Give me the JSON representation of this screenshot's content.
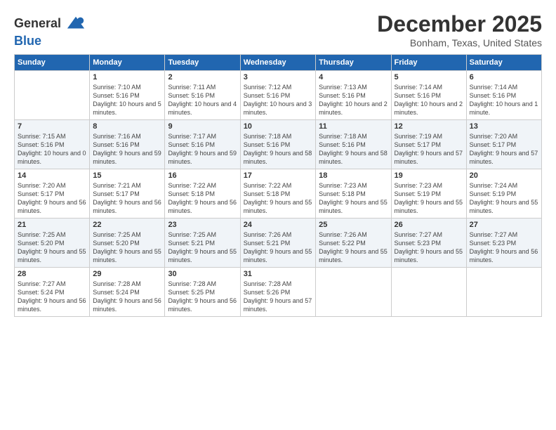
{
  "logo": {
    "line1": "General",
    "line2": "Blue"
  },
  "title": "December 2025",
  "location": "Bonham, Texas, United States",
  "days_header": [
    "Sunday",
    "Monday",
    "Tuesday",
    "Wednesday",
    "Thursday",
    "Friday",
    "Saturday"
  ],
  "weeks": [
    [
      {
        "day": "",
        "sunrise": "",
        "sunset": "",
        "daylight": ""
      },
      {
        "day": "1",
        "sunrise": "Sunrise: 7:10 AM",
        "sunset": "Sunset: 5:16 PM",
        "daylight": "Daylight: 10 hours and 5 minutes."
      },
      {
        "day": "2",
        "sunrise": "Sunrise: 7:11 AM",
        "sunset": "Sunset: 5:16 PM",
        "daylight": "Daylight: 10 hours and 4 minutes."
      },
      {
        "day": "3",
        "sunrise": "Sunrise: 7:12 AM",
        "sunset": "Sunset: 5:16 PM",
        "daylight": "Daylight: 10 hours and 3 minutes."
      },
      {
        "day": "4",
        "sunrise": "Sunrise: 7:13 AM",
        "sunset": "Sunset: 5:16 PM",
        "daylight": "Daylight: 10 hours and 2 minutes."
      },
      {
        "day": "5",
        "sunrise": "Sunrise: 7:14 AM",
        "sunset": "Sunset: 5:16 PM",
        "daylight": "Daylight: 10 hours and 2 minutes."
      },
      {
        "day": "6",
        "sunrise": "Sunrise: 7:14 AM",
        "sunset": "Sunset: 5:16 PM",
        "daylight": "Daylight: 10 hours and 1 minute."
      }
    ],
    [
      {
        "day": "7",
        "sunrise": "Sunrise: 7:15 AM",
        "sunset": "Sunset: 5:16 PM",
        "daylight": "Daylight: 10 hours and 0 minutes."
      },
      {
        "day": "8",
        "sunrise": "Sunrise: 7:16 AM",
        "sunset": "Sunset: 5:16 PM",
        "daylight": "Daylight: 9 hours and 59 minutes."
      },
      {
        "day": "9",
        "sunrise": "Sunrise: 7:17 AM",
        "sunset": "Sunset: 5:16 PM",
        "daylight": "Daylight: 9 hours and 59 minutes."
      },
      {
        "day": "10",
        "sunrise": "Sunrise: 7:18 AM",
        "sunset": "Sunset: 5:16 PM",
        "daylight": "Daylight: 9 hours and 58 minutes."
      },
      {
        "day": "11",
        "sunrise": "Sunrise: 7:18 AM",
        "sunset": "Sunset: 5:16 PM",
        "daylight": "Daylight: 9 hours and 58 minutes."
      },
      {
        "day": "12",
        "sunrise": "Sunrise: 7:19 AM",
        "sunset": "Sunset: 5:17 PM",
        "daylight": "Daylight: 9 hours and 57 minutes."
      },
      {
        "day": "13",
        "sunrise": "Sunrise: 7:20 AM",
        "sunset": "Sunset: 5:17 PM",
        "daylight": "Daylight: 9 hours and 57 minutes."
      }
    ],
    [
      {
        "day": "14",
        "sunrise": "Sunrise: 7:20 AM",
        "sunset": "Sunset: 5:17 PM",
        "daylight": "Daylight: 9 hours and 56 minutes."
      },
      {
        "day": "15",
        "sunrise": "Sunrise: 7:21 AM",
        "sunset": "Sunset: 5:17 PM",
        "daylight": "Daylight: 9 hours and 56 minutes."
      },
      {
        "day": "16",
        "sunrise": "Sunrise: 7:22 AM",
        "sunset": "Sunset: 5:18 PM",
        "daylight": "Daylight: 9 hours and 56 minutes."
      },
      {
        "day": "17",
        "sunrise": "Sunrise: 7:22 AM",
        "sunset": "Sunset: 5:18 PM",
        "daylight": "Daylight: 9 hours and 55 minutes."
      },
      {
        "day": "18",
        "sunrise": "Sunrise: 7:23 AM",
        "sunset": "Sunset: 5:18 PM",
        "daylight": "Daylight: 9 hours and 55 minutes."
      },
      {
        "day": "19",
        "sunrise": "Sunrise: 7:23 AM",
        "sunset": "Sunset: 5:19 PM",
        "daylight": "Daylight: 9 hours and 55 minutes."
      },
      {
        "day": "20",
        "sunrise": "Sunrise: 7:24 AM",
        "sunset": "Sunset: 5:19 PM",
        "daylight": "Daylight: 9 hours and 55 minutes."
      }
    ],
    [
      {
        "day": "21",
        "sunrise": "Sunrise: 7:25 AM",
        "sunset": "Sunset: 5:20 PM",
        "daylight": "Daylight: 9 hours and 55 minutes."
      },
      {
        "day": "22",
        "sunrise": "Sunrise: 7:25 AM",
        "sunset": "Sunset: 5:20 PM",
        "daylight": "Daylight: 9 hours and 55 minutes."
      },
      {
        "day": "23",
        "sunrise": "Sunrise: 7:25 AM",
        "sunset": "Sunset: 5:21 PM",
        "daylight": "Daylight: 9 hours and 55 minutes."
      },
      {
        "day": "24",
        "sunrise": "Sunrise: 7:26 AM",
        "sunset": "Sunset: 5:21 PM",
        "daylight": "Daylight: 9 hours and 55 minutes."
      },
      {
        "day": "25",
        "sunrise": "Sunrise: 7:26 AM",
        "sunset": "Sunset: 5:22 PM",
        "daylight": "Daylight: 9 hours and 55 minutes."
      },
      {
        "day": "26",
        "sunrise": "Sunrise: 7:27 AM",
        "sunset": "Sunset: 5:23 PM",
        "daylight": "Daylight: 9 hours and 55 minutes."
      },
      {
        "day": "27",
        "sunrise": "Sunrise: 7:27 AM",
        "sunset": "Sunset: 5:23 PM",
        "daylight": "Daylight: 9 hours and 56 minutes."
      }
    ],
    [
      {
        "day": "28",
        "sunrise": "Sunrise: 7:27 AM",
        "sunset": "Sunset: 5:24 PM",
        "daylight": "Daylight: 9 hours and 56 minutes."
      },
      {
        "day": "29",
        "sunrise": "Sunrise: 7:28 AM",
        "sunset": "Sunset: 5:24 PM",
        "daylight": "Daylight: 9 hours and 56 minutes."
      },
      {
        "day": "30",
        "sunrise": "Sunrise: 7:28 AM",
        "sunset": "Sunset: 5:25 PM",
        "daylight": "Daylight: 9 hours and 56 minutes."
      },
      {
        "day": "31",
        "sunrise": "Sunrise: 7:28 AM",
        "sunset": "Sunset: 5:26 PM",
        "daylight": "Daylight: 9 hours and 57 minutes."
      },
      {
        "day": "",
        "sunrise": "",
        "sunset": "",
        "daylight": ""
      },
      {
        "day": "",
        "sunrise": "",
        "sunset": "",
        "daylight": ""
      },
      {
        "day": "",
        "sunrise": "",
        "sunset": "",
        "daylight": ""
      }
    ]
  ]
}
